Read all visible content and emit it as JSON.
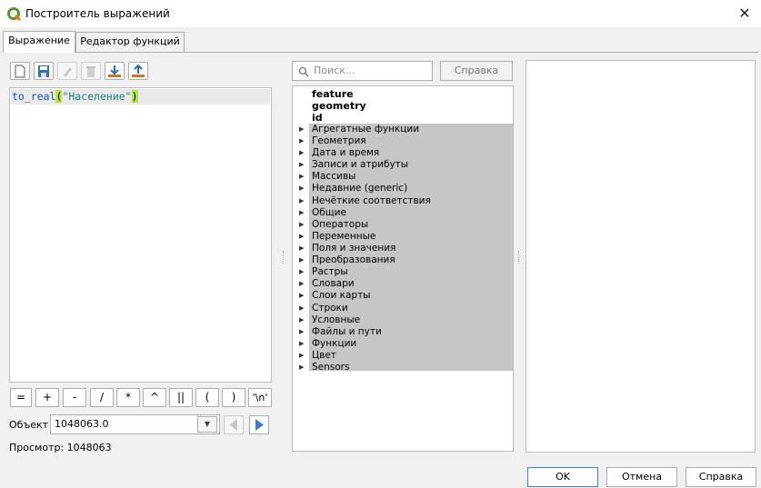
{
  "window": {
    "title": "Построитель выражений",
    "close_label": "✕"
  },
  "tabs": [
    {
      "label": "Выражение",
      "active": true
    },
    {
      "label": "Редактор функций",
      "active": false
    }
  ],
  "toolbar": {
    "buttons": [
      "new-icon",
      "save-icon",
      "edit-icon",
      "delete-icon",
      "import-icon",
      "export-icon"
    ]
  },
  "editor": {
    "fn": "to_real",
    "open_paren": "(",
    "string": "\"Население\"",
    "close_paren": ")"
  },
  "operators": [
    "=",
    "+",
    "-",
    "/",
    "*",
    "^",
    "||",
    "(",
    ")",
    "'\\n'"
  ],
  "object": {
    "label": "Объект",
    "value": "1048063.0"
  },
  "preview": {
    "label": "Просмотр:",
    "value": "1048063"
  },
  "search": {
    "placeholder": "Поиск..."
  },
  "help_inline_label": "Справка",
  "tree": {
    "fields": [
      "feature",
      "geometry",
      "id"
    ],
    "groups": [
      "Агрегатные функции",
      "Геометрия",
      "Дата и время",
      "Записи и атрибуты",
      "Массивы",
      "Недавние (generic)",
      "Нечёткие соответствия",
      "Общие",
      "Операторы",
      "Переменные",
      "Поля и значения",
      "Преобразования",
      "Растры",
      "Словари",
      "Слои карты",
      "Строки",
      "Условные",
      "Файлы и пути",
      "Функции",
      "Цвет",
      "Sensors"
    ]
  },
  "buttons": {
    "ok": "OK",
    "cancel": "Отмена",
    "help": "Справка"
  },
  "colors": {
    "accent": "#3b7fd6",
    "paren_highlight": "#b7e53d",
    "function": "#1f4fb4",
    "string": "#1f7f7f",
    "group_bg": "#c6c6c6"
  }
}
